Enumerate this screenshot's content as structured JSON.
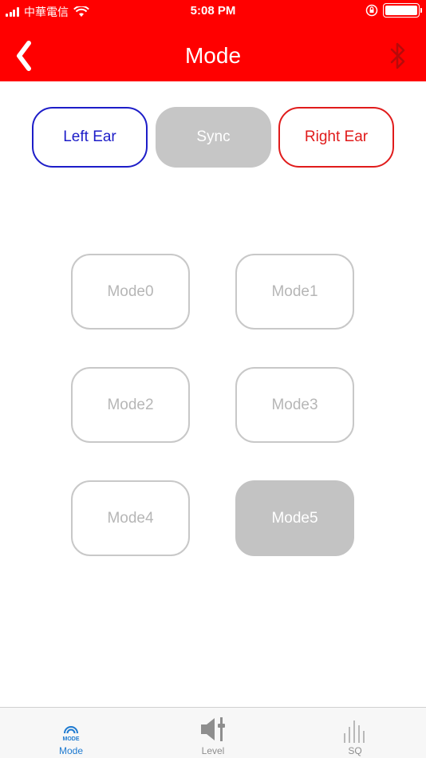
{
  "status_bar": {
    "carrier": "中華電信",
    "time": "5:08 PM",
    "battery_level": 1.0
  },
  "nav": {
    "title": "Mode",
    "back_icon": "chevron-left-icon",
    "bluetooth_icon": "bluetooth-icon"
  },
  "ear_selector": {
    "left_label": "Left Ear",
    "sync_label": "Sync",
    "right_label": "Right Ear",
    "selected": "Sync"
  },
  "modes": {
    "items": [
      "Mode0",
      "Mode1",
      "Mode2",
      "Mode3",
      "Mode4",
      "Mode5"
    ],
    "selected": "Mode5"
  },
  "tabs": {
    "items": [
      {
        "label": "Mode",
        "icon_text": "MODE",
        "icon": "mode-icon"
      },
      {
        "label": "Level",
        "icon": "speaker-level-icon"
      },
      {
        "label": "SQ",
        "icon": "equalizer-bars-icon"
      }
    ],
    "active": "Mode"
  },
  "colors": {
    "header": "#ff0000",
    "left_ear": "#1d1dc8",
    "right_ear": "#e01b1b",
    "selected_fill": "#c3c3c3",
    "tab_active": "#1e7ad0",
    "tab_inactive": "#8e8e8e"
  }
}
